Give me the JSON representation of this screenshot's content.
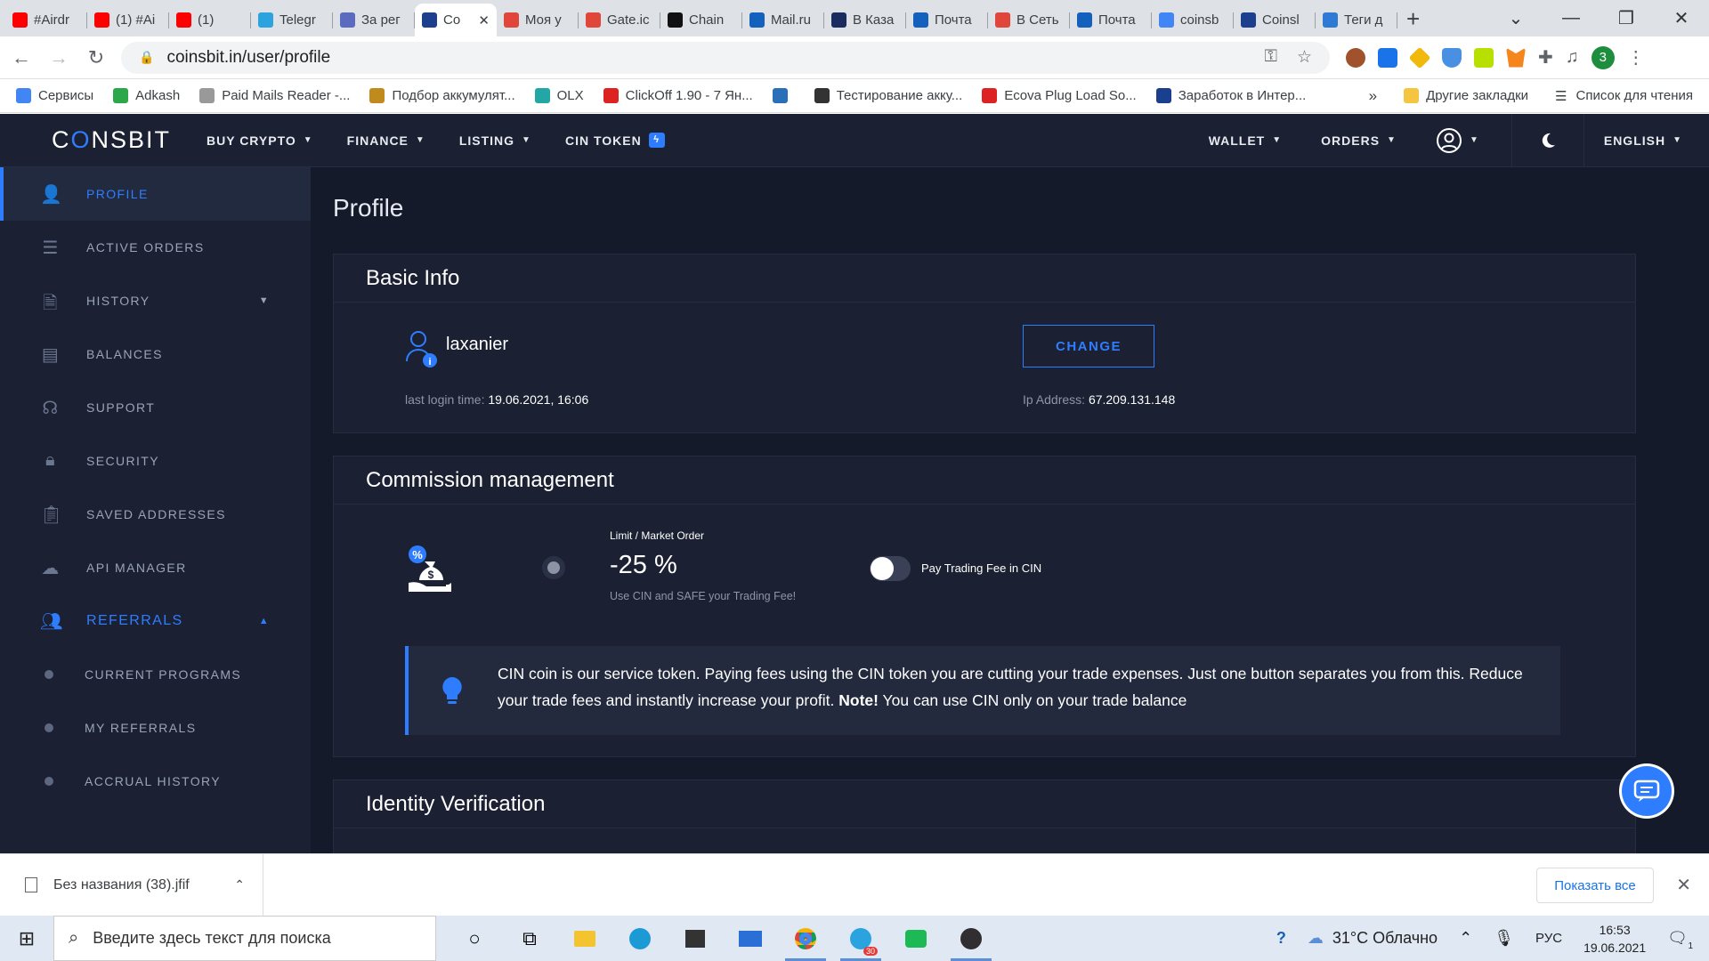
{
  "browser": {
    "tabs": [
      {
        "label": "#Airdr",
        "color": "#ff0000"
      },
      {
        "label": "(1) #Ai",
        "color": "#ff0000"
      },
      {
        "label": "(1)",
        "color": "#ff0000"
      },
      {
        "label": "Telegr",
        "color": "#2aa3df"
      },
      {
        "label": "За рег",
        "color": "#5b6bbf"
      },
      {
        "label": "Co",
        "color": "#1c3f8e",
        "active": true
      },
      {
        "label": "Моя у",
        "color": "#e0463a"
      },
      {
        "label": "Gate.ic",
        "color": "#e0463a"
      },
      {
        "label": "Chain",
        "color": "#111111"
      },
      {
        "label": "Mail.ru",
        "color": "#1460bd"
      },
      {
        "label": "В Каза",
        "color": "#1a2b5f"
      },
      {
        "label": "Почта",
        "color": "#1460bd"
      },
      {
        "label": "В Сеть",
        "color": "#e0463a"
      },
      {
        "label": "Почта",
        "color": "#1460bd"
      },
      {
        "label": "coinsb",
        "color": "#4285f4"
      },
      {
        "label": "Coinsl",
        "color": "#1c3f8e"
      },
      {
        "label": "Теги д",
        "color": "#2e7bd6"
      }
    ],
    "new_tab": "+",
    "url": "coinsbit.in/user/profile",
    "profile_initial": "3",
    "bookmarks": [
      {
        "label": "Сервисы",
        "color": "#4285f4"
      },
      {
        "label": "Adkash",
        "color": "#2ca84a"
      },
      {
        "label": "Paid Mails Reader -...",
        "color": "#999999"
      },
      {
        "label": "Подбор аккумулят...",
        "color": "#c08a1d"
      },
      {
        "label": "OLX",
        "color": "#23a7a5"
      },
      {
        "label": "ClickOff 1.90 - 7 Ян...",
        "color": "#d22"
      },
      {
        "label": "",
        "color": "#2a6fb8"
      },
      {
        "label": "Тестирование акку...",
        "color": "#333333"
      },
      {
        "label": "Ecova Plug Load So...",
        "color": "#d22"
      },
      {
        "label": "Заработок в Интер...",
        "color": "#1b3f8f"
      }
    ],
    "bookmarks_more": "»",
    "other_bookmarks": "Другие закладки",
    "reading_list": "Список для чтения"
  },
  "site": {
    "logo_prefix": "C",
    "logo_mark": "O",
    "logo_suffix": "NSBIT",
    "menu": [
      "BUY CRYPTO",
      "FINANCE",
      "LISTING",
      "CIN TOKEN"
    ],
    "right_menu": [
      "WALLET",
      "ORDERS"
    ],
    "language": "ENGLISH",
    "sidebar": [
      {
        "label": "PROFILE",
        "icon": "user-icon",
        "active": true
      },
      {
        "label": "ACTIVE ORDERS",
        "icon": "orders-icon"
      },
      {
        "label": "HISTORY",
        "icon": "history-icon"
      },
      {
        "label": "BALANCES",
        "icon": "wallet-icon"
      },
      {
        "label": "SUPPORT",
        "icon": "support-icon"
      },
      {
        "label": "SECURITY",
        "icon": "lock-icon"
      },
      {
        "label": "SAVED ADDRESSES",
        "icon": "clipboard-icon"
      },
      {
        "label": "API MANAGER",
        "icon": "cloud-icon"
      },
      {
        "label": "REFERRALS",
        "icon": "users-icon"
      },
      {
        "label": "CURRENT PROGRAMS"
      },
      {
        "label": "MY REFERRALS"
      },
      {
        "label": "ACCRUAL HISTORY"
      }
    ],
    "page_title": "Profile",
    "basic_info": {
      "title": "Basic Info",
      "username": "laxanier",
      "last_login_label": "last login time:",
      "last_login_value": "19.06.2021, 16:06",
      "change_button": "CHANGE",
      "ip_label": "Ip Address:",
      "ip_value": "67.209.131.148"
    },
    "commission": {
      "title": "Commission management",
      "order_type": "Limit / Market Order",
      "discount": "-25 %",
      "discount_hint": "Use CIN and SAFE your Trading Fee!",
      "toggle_label": "Pay Trading Fee in CIN",
      "toggle_on": false,
      "note_text_1": "CIN coin is our service token. Paying fees using the CIN token you are cutting your trade expenses. Just one button separates you from this. Reduce your trade fees and instantly increase your profit.",
      "note_bold": "Note!",
      "note_text_2": "You can use CIN only on your trade balance"
    },
    "identity": {
      "title": "Identity Verification"
    },
    "accent": "#2f7dff"
  },
  "downloads": {
    "file_name": "Без названия (38).jfif",
    "show_all": "Показать все"
  },
  "taskbar": {
    "search_placeholder": "Введите здесь текст для поиска",
    "weather": "31°C  Облачно",
    "language": "РУС",
    "time": "16:53",
    "date": "19.06.2021",
    "telegram_badge": "30",
    "notifications": "1"
  }
}
